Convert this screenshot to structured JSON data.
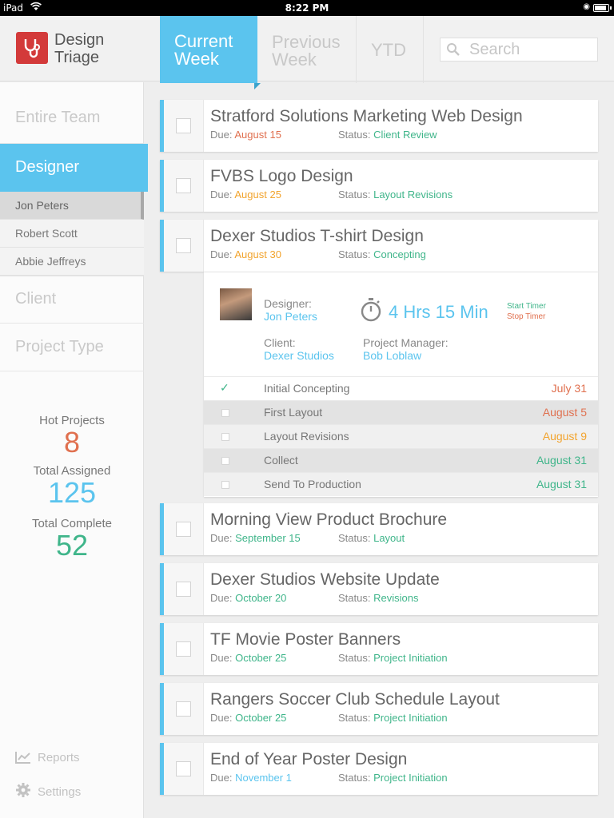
{
  "status_bar": {
    "carrier": "iPad",
    "time": "8:22 PM"
  },
  "header": {
    "brand": [
      "Design",
      "Triage"
    ],
    "tabs": [
      {
        "label": [
          "Current",
          "Week"
        ],
        "active": true
      },
      {
        "label": [
          "Previous",
          "Week"
        ],
        "active": false
      },
      {
        "label": [
          "YTD"
        ],
        "active": false
      }
    ],
    "search": {
      "placeholder": "Search"
    }
  },
  "sidebar": {
    "sections": {
      "entire_team": "Entire Team",
      "designer": "Designer",
      "client": "Client",
      "project_type": "Project Type"
    },
    "designers": [
      "Jon Peters",
      "Robert Scott",
      "Abbie Jeffreys"
    ],
    "stats": {
      "hot_label": "Hot Projects",
      "hot_value": "8",
      "assigned_label": "Total Assigned",
      "assigned_value": "125",
      "complete_label": "Total Complete",
      "complete_value": "52"
    },
    "footer": {
      "reports": "Reports",
      "settings": "Settings"
    }
  },
  "labels": {
    "due": "Due:",
    "status": "Status:"
  },
  "projects": [
    {
      "title": "Stratford Solutions Marketing Web Design",
      "due": "August 15",
      "status": "Client Review"
    },
    {
      "title": "FVBS Logo Design",
      "due": "August 25",
      "status": "Layout Revisions"
    },
    {
      "title": "Dexer Studios T-shirt Design",
      "due": "August 30",
      "status": "Concepting"
    },
    {
      "title": "Morning View Product Brochure",
      "due": "September 15",
      "status": "Layout"
    },
    {
      "title": "Dexer Studios Website Update",
      "due": "October 20",
      "status": "Revisions"
    },
    {
      "title": "TF Movie Poster Banners",
      "due": "October 25",
      "status": "Project Initiation"
    },
    {
      "title": "Rangers Soccer Club Schedule Layout",
      "due": "October 25",
      "status": "Project Initiation"
    },
    {
      "title": "End of Year Poster Design",
      "due": "November 1",
      "status": "Project Initiation"
    }
  ],
  "detail": {
    "designer_label": "Designer:",
    "designer": "Jon Peters",
    "client_label": "Client:",
    "client": "Dexer Studios",
    "pm_label": "Project Manager:",
    "pm": "Bob Loblaw",
    "timer": "4 Hrs 15 Min",
    "start_timer": "Start Timer",
    "stop_timer": "Stop Timer",
    "tasks": [
      {
        "name": "Initial Concepting",
        "date": "July 31",
        "done": true
      },
      {
        "name": "First Layout",
        "date": "August 5",
        "done": false
      },
      {
        "name": "Layout Revisions",
        "date": "August 9",
        "done": false
      },
      {
        "name": "Collect",
        "date": "August 31",
        "done": false
      },
      {
        "name": "Send To Production",
        "date": "August 31",
        "done": false
      }
    ]
  },
  "colors": {
    "accent": "#5bc4ee",
    "red": "#e0704f",
    "orange": "#f2a42e",
    "green": "#3fb58a",
    "brand": "#d33a3a"
  }
}
